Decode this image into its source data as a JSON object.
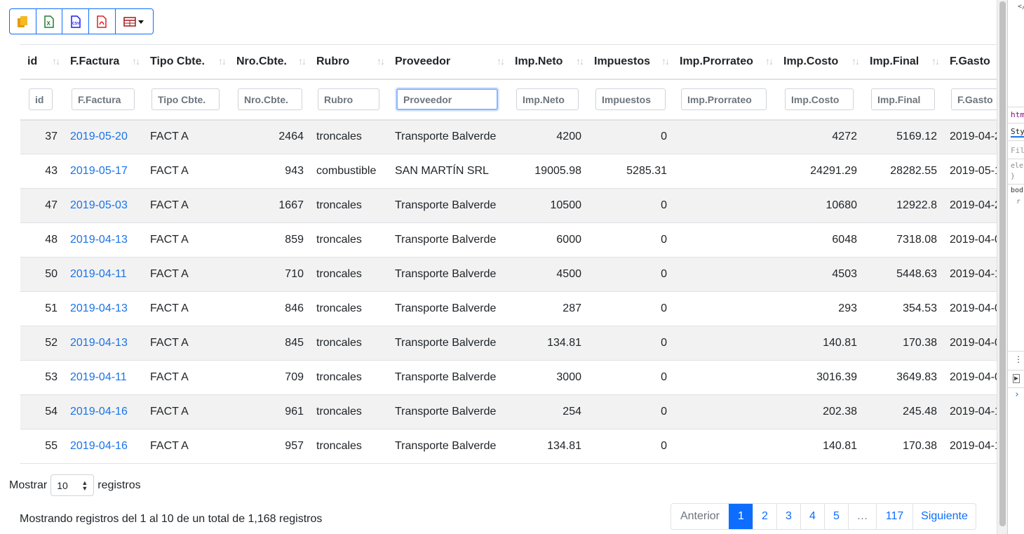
{
  "toolbar": {
    "buttons": [
      {
        "name": "copy-icon",
        "color": "#f0a500"
      },
      {
        "name": "excel-icon",
        "color": "#1e7e34"
      },
      {
        "name": "csv-icon",
        "color": "#1a1aff"
      },
      {
        "name": "pdf-icon",
        "color": "#e02020"
      },
      {
        "name": "columns-icon",
        "color": "#a01818"
      }
    ],
    "csv_label": "CSV"
  },
  "table": {
    "columns": [
      "id",
      "F.Factura",
      "Tipo Cbte.",
      "Nro.Cbte.",
      "Rubro",
      "Proveedor",
      "Imp.Neto",
      "Impuestos",
      "Imp.Prorrateo",
      "Imp.Costo",
      "Imp.Final",
      "F.Gasto"
    ],
    "filters": [
      "id",
      "F.Factura",
      "Tipo Cbte.",
      "Nro.Cbte.",
      "Rubro",
      "Proveedor",
      "Imp.Neto",
      "Impuestos",
      "Imp.Prorrateo",
      "Imp.Costo",
      "Imp.Final",
      "F.Gasto"
    ],
    "rows": [
      [
        "37",
        "2019-05-20",
        "FACT A",
        "2464",
        "troncales",
        "Transporte Balverde",
        "4200",
        "0",
        "",
        "4272",
        "5169.12",
        "2019-04-2"
      ],
      [
        "43",
        "2019-05-17",
        "FACT A",
        "943",
        "combustible",
        "SAN MARTÍN SRL",
        "19005.98",
        "5285.31",
        "",
        "24291.29",
        "28282.55",
        "2019-05-1"
      ],
      [
        "47",
        "2019-05-03",
        "FACT A",
        "1667",
        "troncales",
        "Transporte Balverde",
        "10500",
        "0",
        "",
        "10680",
        "12922.8",
        "2019-04-2"
      ],
      [
        "48",
        "2019-04-13",
        "FACT A",
        "859",
        "troncales",
        "Transporte Balverde",
        "6000",
        "0",
        "",
        "6048",
        "7318.08",
        "2019-04-0"
      ],
      [
        "50",
        "2019-04-11",
        "FACT A",
        "710",
        "troncales",
        "Transporte Balverde",
        "4500",
        "0",
        "",
        "4503",
        "5448.63",
        "2019-04-1"
      ],
      [
        "51",
        "2019-04-13",
        "FACT A",
        "846",
        "troncales",
        "Transporte Balverde",
        "287",
        "0",
        "",
        "293",
        "354.53",
        "2019-04-0"
      ],
      [
        "52",
        "2019-04-13",
        "FACT A",
        "845",
        "troncales",
        "Transporte Balverde",
        "134.81",
        "0",
        "",
        "140.81",
        "170.38",
        "2019-04-0"
      ],
      [
        "53",
        "2019-04-11",
        "FACT A",
        "709",
        "troncales",
        "Transporte Balverde",
        "3000",
        "0",
        "",
        "3016.39",
        "3649.83",
        "2019-04-0"
      ],
      [
        "54",
        "2019-04-16",
        "FACT A",
        "961",
        "troncales",
        "Transporte Balverde",
        "254",
        "0",
        "",
        "202.38",
        "245.48",
        "2019-04-1"
      ],
      [
        "55",
        "2019-04-16",
        "FACT A",
        "957",
        "troncales",
        "Transporte Balverde",
        "134.81",
        "0",
        "",
        "140.81",
        "170.38",
        "2019-04-1"
      ]
    ]
  },
  "length": {
    "prefix": "Mostrar",
    "value": "10",
    "suffix": "registros"
  },
  "info": "Mostrando registros del 1 al 10 de un total de 1,168 registros",
  "pagination": {
    "items": [
      "Anterior",
      "1",
      "2",
      "3",
      "4",
      "5",
      "…",
      "117",
      "Siguiente"
    ],
    "active": "1"
  },
  "devtools": {
    "snippets": [
      "</",
      "htm",
      "Sty",
      "Filt",
      "ele",
      "}",
      "bod",
      "r",
      "⋮",
      "▶",
      "›"
    ]
  }
}
